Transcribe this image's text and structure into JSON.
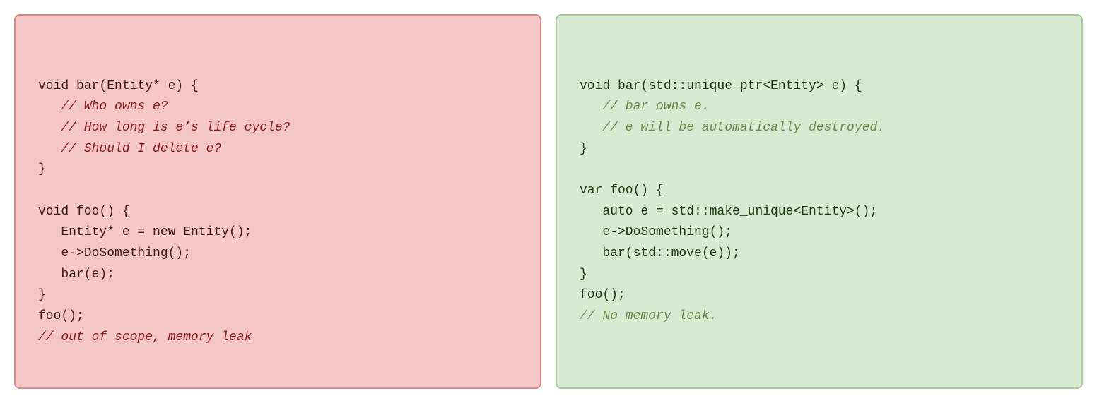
{
  "panels": {
    "bad": {
      "label": "bad-code-panel",
      "lines": [
        {
          "text": "void bar(Entity* e) {",
          "type": "code"
        },
        {
          "text": "   // Who owns e?",
          "type": "comment"
        },
        {
          "text": "   // How long is e’s life cycle?",
          "type": "comment"
        },
        {
          "text": "   // Should I delete e?",
          "type": "comment"
        },
        {
          "text": "}",
          "type": "code"
        },
        {
          "text": "",
          "type": "code"
        },
        {
          "text": "void foo() {",
          "type": "code"
        },
        {
          "text": "   Entity* e = new Entity();",
          "type": "code"
        },
        {
          "text": "   e->DoSomething();",
          "type": "code"
        },
        {
          "text": "   bar(e);",
          "type": "code"
        },
        {
          "text": "}",
          "type": "code"
        },
        {
          "text": "foo();",
          "type": "code"
        },
        {
          "text": "// out of scope, memory leak",
          "type": "comment"
        }
      ]
    },
    "good": {
      "label": "good-code-panel",
      "lines": [
        {
          "text": "void bar(std::unique_ptr<Entity> e) {",
          "type": "code"
        },
        {
          "text": "   // bar owns e.",
          "type": "comment"
        },
        {
          "text": "   // e will be automatically destroyed.",
          "type": "comment"
        },
        {
          "text": "}",
          "type": "code"
        },
        {
          "text": "",
          "type": "code"
        },
        {
          "text": "var foo() {",
          "type": "code"
        },
        {
          "text": "   auto e = std::make_unique<Entity>();",
          "type": "code"
        },
        {
          "text": "   e->DoSomething();",
          "type": "code"
        },
        {
          "text": "   bar(std::move(e));",
          "type": "code"
        },
        {
          "text": "}",
          "type": "code"
        },
        {
          "text": "foo();",
          "type": "code"
        },
        {
          "text": "// No memory leak.",
          "type": "comment"
        }
      ]
    }
  }
}
